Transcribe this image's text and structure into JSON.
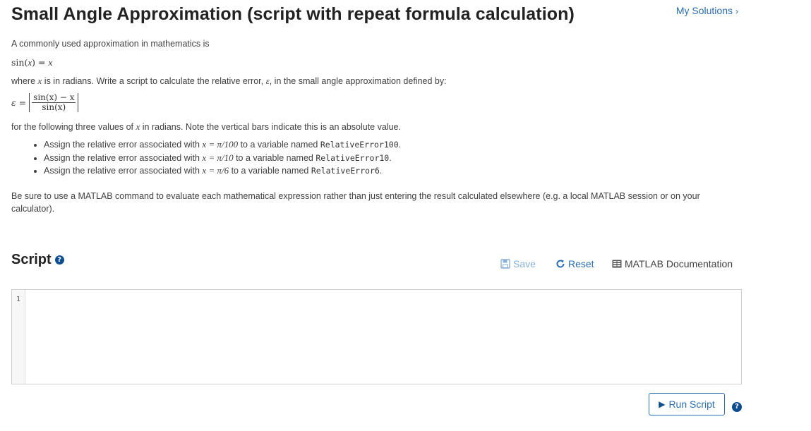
{
  "header": {
    "title": "Small Angle Approximation (script with repeat formula calculation)",
    "my_solutions": "My Solutions",
    "chevron": "›"
  },
  "description": {
    "intro": "A commonly used approximation in mathematics is",
    "eq1_lhs": "sin(",
    "eq1_var": "x",
    "eq1_rhs": ") =",
    "eq1_var2": "x",
    "where_a": "where",
    "where_var": "x",
    "where_b": "is in radians. Write a script to calculate the relative error,",
    "where_eps": "ε",
    "where_c": ", in the small angle approximation defined by:",
    "eps_lhs": "ε =",
    "frac_num": "sin(x) − x",
    "frac_den": "sin(x)",
    "following_a": "for the following three values of",
    "following_var": "x",
    "following_b": "in radians.  Note the vertical bars indicate this is an absolute value.",
    "tasks": [
      {
        "pre": "Assign the relative error associated with",
        "math": "x = π/100",
        "mid": "to a variable named",
        "var": "RelativeError100",
        "post": "."
      },
      {
        "pre": "Assign the relative error associated with",
        "math": "x = π/10",
        "mid": "to a variable named",
        "var": "RelativeError10",
        "post": "."
      },
      {
        "pre": "Assign the relative error associated with",
        "math": "x = π/6",
        "mid": "to a variable named",
        "var": "RelativeError6",
        "post": "."
      }
    ],
    "note_line1": "Be sure to use a MATLAB command to evaluate each mathematical expression rather than just entering the result calculated elsewhere (e.g. a local MATLAB session or on your",
    "note_line2": "calculator)."
  },
  "script": {
    "heading": "Script",
    "help_glyph": "?",
    "save_label": "Save",
    "reset_label": "Reset",
    "docs_label": "MATLAB Documentation",
    "line_number": "1",
    "code": "",
    "run_label": "Run Script",
    "run_glyph": "▶"
  },
  "colors": {
    "link": "#2a6eb6",
    "save_disabled": "#8ab0d8",
    "help_icon": "#0e4d8f"
  }
}
